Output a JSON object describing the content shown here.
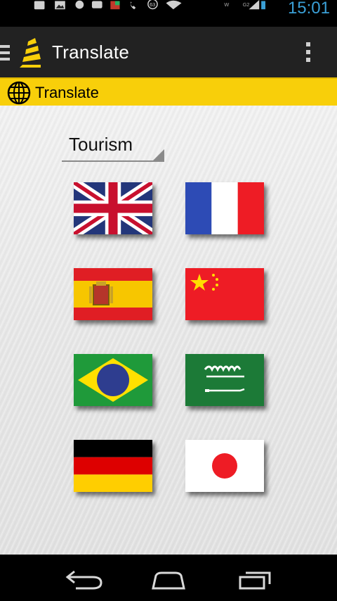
{
  "status_bar": {
    "time": "15:01",
    "battery_badge": "63",
    "signal_label": "G2"
  },
  "action_bar": {
    "title": "Translate"
  },
  "section": {
    "title": "Translate"
  },
  "category_spinner": {
    "selected": "Tourism"
  },
  "languages": [
    {
      "flag": "united-kingdom"
    },
    {
      "flag": "france"
    },
    {
      "flag": "spain"
    },
    {
      "flag": "china"
    },
    {
      "flag": "brazil"
    },
    {
      "flag": "saudi-arabia"
    },
    {
      "flag": "germany"
    },
    {
      "flag": "japan"
    }
  ],
  "colors": {
    "action_bar_bg": "#222222",
    "section_header_bg": "#f8cf0a",
    "clock_color": "#3a9fd6"
  }
}
